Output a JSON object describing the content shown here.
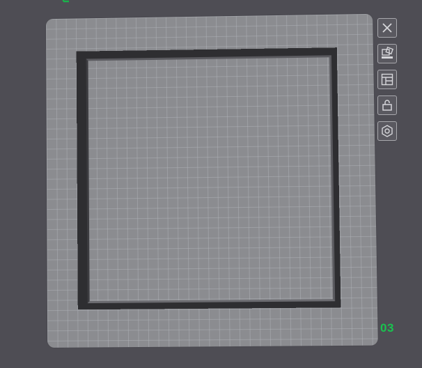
{
  "viewport": {
    "background": "#4e4d54",
    "plate_color": "#8b8c90",
    "model_color": "#2e2e31",
    "accent_green": "#19c34f"
  },
  "axis": {
    "icon": "axis-z-icon"
  },
  "toolbar": {
    "buttons": [
      {
        "name": "close-button",
        "icon": "close-icon"
      },
      {
        "name": "arrange-button",
        "icon": "arrange-icon"
      },
      {
        "name": "layout-button",
        "icon": "layout-icon"
      },
      {
        "name": "lock-button",
        "icon": "unlock-icon"
      },
      {
        "name": "settings-button",
        "icon": "hex-nut-icon"
      }
    ]
  },
  "status": {
    "plate_number": "03"
  }
}
